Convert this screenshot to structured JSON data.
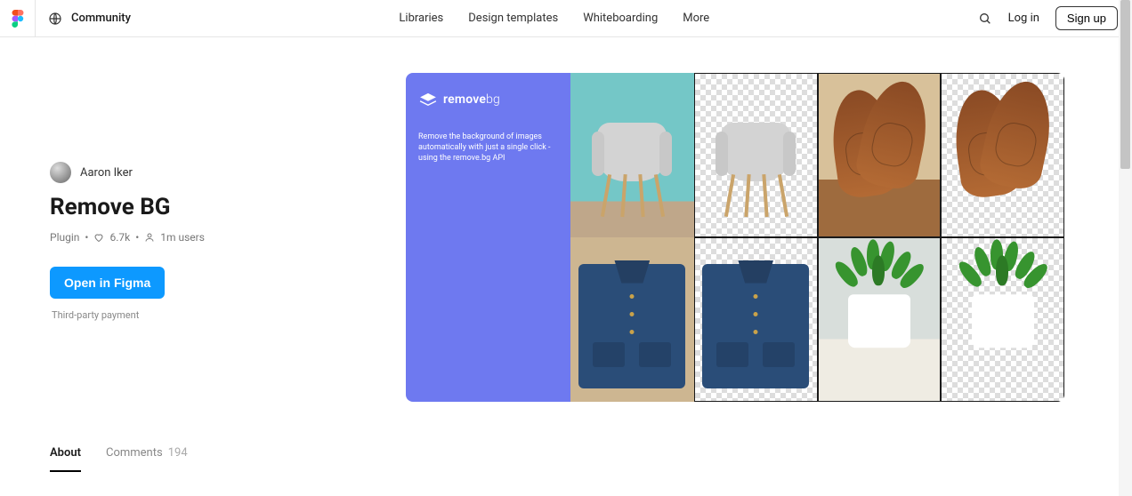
{
  "header": {
    "community": "Community",
    "nav": {
      "libraries": "Libraries",
      "templates": "Design templates",
      "whiteboarding": "Whiteboarding",
      "more": "More"
    },
    "login": "Log in",
    "signup": "Sign up"
  },
  "page": {
    "author": "Aaron Iker",
    "title": "Remove BG",
    "type": "Plugin",
    "likes": "6.7k",
    "users": "1m users",
    "open_button": "Open in Figma",
    "third_party": "Third-party payment"
  },
  "hero": {
    "brand": "remove",
    "brand_suffix": "bg",
    "desc": "Remove the background of images automatically with just a single click - using the remove.bg API"
  },
  "tabs": {
    "about": "About",
    "comments": "Comments",
    "comments_count": "194"
  }
}
